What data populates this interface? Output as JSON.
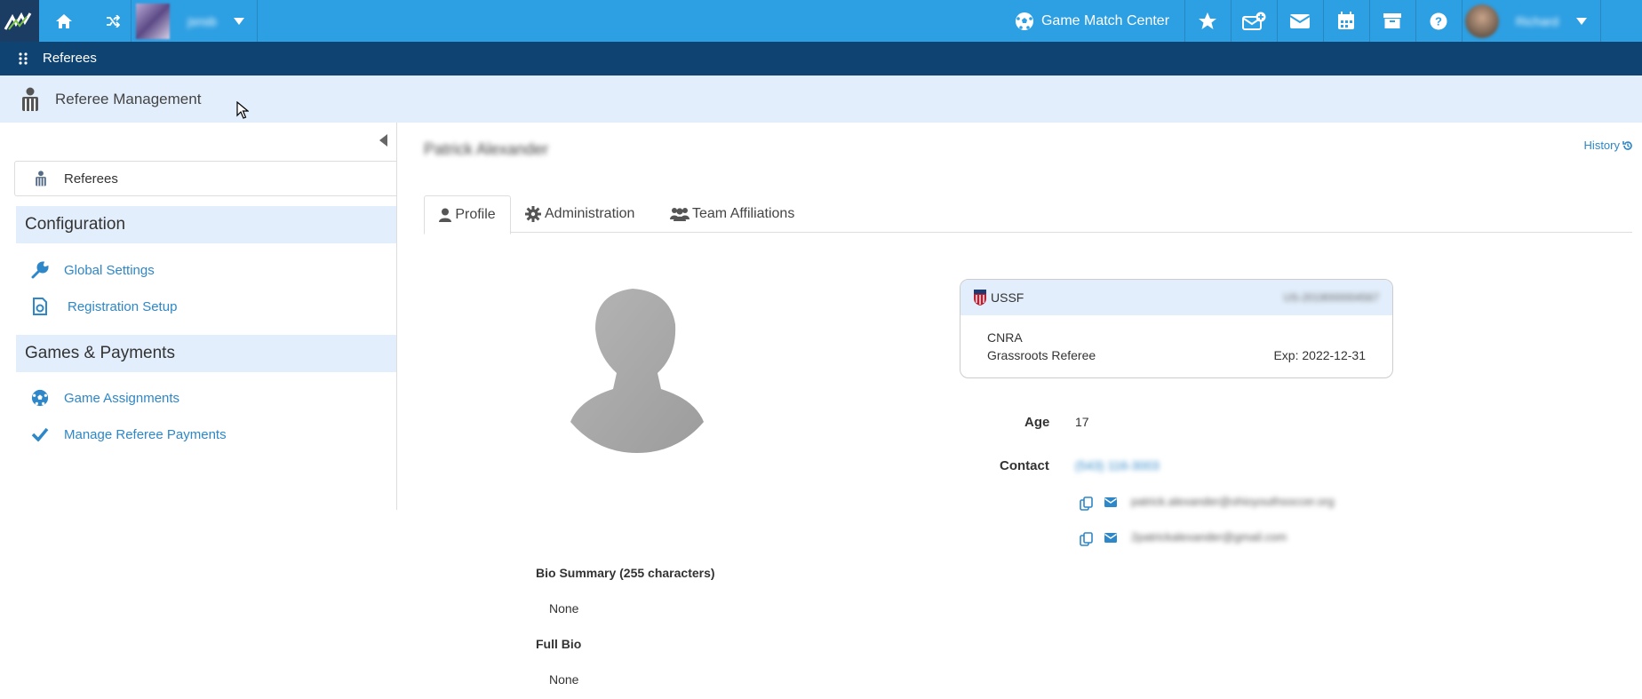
{
  "topbar": {
    "account_name": "jsnsb",
    "game_match_center": "Game Match Center",
    "user_name": "Richard",
    "icons": [
      "home-icon",
      "shuffle-icon",
      "soccer-ball-icon",
      "star-icon",
      "envelope-plus-icon",
      "envelope-icon",
      "calendar-icon",
      "archive-icon",
      "help-icon"
    ]
  },
  "subbar": {
    "title": "Referees"
  },
  "page_header": {
    "title": "Referee Management"
  },
  "sidebar": {
    "top_item": "Referees",
    "sections": [
      {
        "title": "Configuration",
        "items": [
          "Global Settings",
          "Registration Setup"
        ]
      },
      {
        "title": "Games & Payments",
        "items": [
          "Game Assignments",
          "Manage Referee Payments"
        ]
      }
    ]
  },
  "profile": {
    "name": "Patrick Alexander",
    "history_label": "History",
    "tabs": [
      "Profile",
      "Administration",
      "Team Affiliations"
    ],
    "active_tab": "Profile",
    "license_card": {
      "org": "USSF",
      "id": "US-2019000004567",
      "grade": "CNRA",
      "level": "Grassroots Referee",
      "expiry": "Exp: 2022-12-31"
    },
    "age_label": "Age",
    "age": "17",
    "contact_label": "Contact",
    "phone": "(543) 116-3003",
    "emails": [
      "patrick.alexander@ohioyouthsoccer.org",
      "2patrickalexander@gmail.com"
    ],
    "bio_summary_label": "Bio Summary (255 characters)",
    "bio_summary": "None",
    "full_bio_label": "Full Bio",
    "full_bio": "None"
  },
  "colors": {
    "primary": "#2d9fe3",
    "navy": "#0f4472",
    "light": "#e2eefb",
    "link": "#2d87c8"
  }
}
